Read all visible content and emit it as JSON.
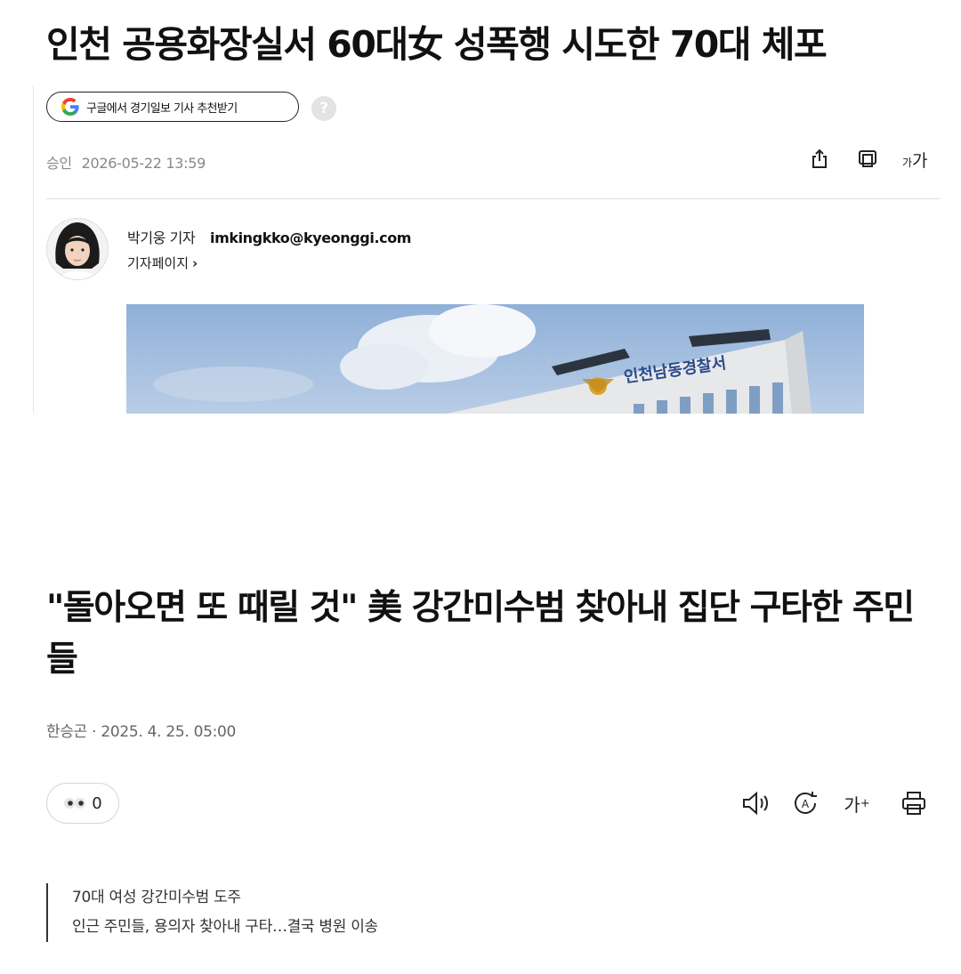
{
  "article1": {
    "headline": "인천 공용화장실서 60대女 성폭행 시도한 70대 체포",
    "google_button_label": "구글에서 경기일보 기사 추천받기",
    "help_symbol": "?",
    "approval_label": "승인",
    "datetime": "2026-05-22 13:59",
    "font_size_small": "가",
    "font_size_large": "가",
    "author": {
      "name": "박기웅 기자",
      "email": "imkingkko@kyeonggi.com",
      "page_link": "기자페이지",
      "page_chevron": "›"
    },
    "photo_sign_text": "인천남동경찰서"
  },
  "article2": {
    "headline": "\"돌아오면 또 때릴 것\" 美 강간미수범 찾아내 집단 구타한 주민들",
    "byline": "한승곤 · 2025. 4. 25. 05:00",
    "view_count": "0",
    "font_button": "가",
    "font_button_plus": "+",
    "summary": [
      "70대 여성 강간미수범 도주",
      "인근 주민들, 용의자 찾아내 구타…결국 병원 이송"
    ]
  },
  "colors": {
    "text": "#111111",
    "meta_gray": "#888888",
    "divider": "#dcdcdc",
    "sky": "#9fb8d8",
    "building": "#e8e8ea",
    "sign_blue": "#2a4a8c"
  },
  "icons": [
    "google-g-icon",
    "help-icon",
    "share-icon",
    "copy-icon",
    "font-size-icon",
    "eyes-icon",
    "speaker-icon",
    "translate-icon",
    "print-icon"
  ]
}
